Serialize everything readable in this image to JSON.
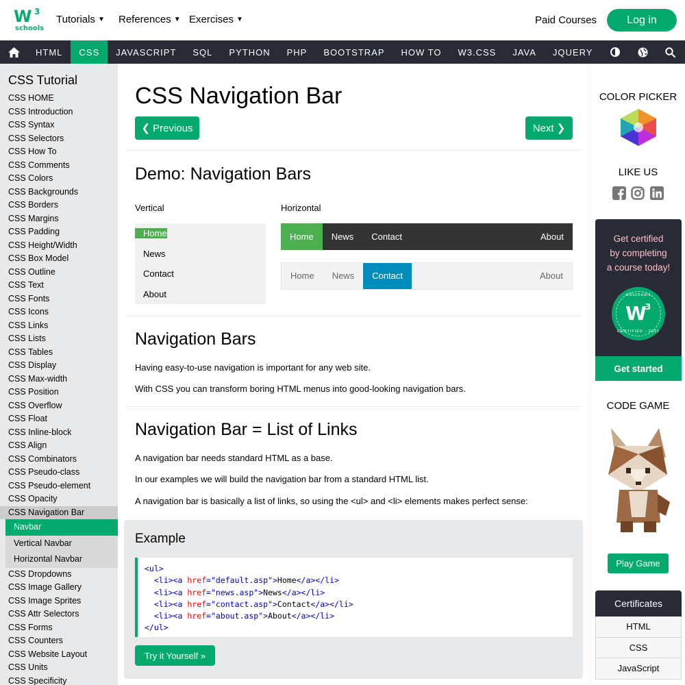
{
  "header": {
    "logo_main": "W",
    "logo_sup": "3",
    "logo_sub": "schools",
    "menus": [
      {
        "label": "Tutorials"
      },
      {
        "label": "References"
      },
      {
        "label": "Exercises"
      }
    ],
    "paid_courses": "Paid Courses",
    "login": "Log in"
  },
  "nav": {
    "items": [
      "HTML",
      "CSS",
      "JAVASCRIPT",
      "SQL",
      "PYTHON",
      "PHP",
      "BOOTSTRAP",
      "HOW TO",
      "W3.CSS",
      "JAVA",
      "JQUERY"
    ],
    "active": "CSS"
  },
  "sidebar": {
    "title": "CSS Tutorial",
    "items_top": [
      "CSS HOME",
      "CSS Introduction",
      "CSS Syntax",
      "CSS Selectors",
      "CSS How To",
      "CSS Comments",
      "CSS Colors",
      "CSS Backgrounds",
      "CSS Borders",
      "CSS Margins",
      "CSS Padding",
      "CSS Height/Width",
      "CSS Box Model",
      "CSS Outline",
      "CSS Text",
      "CSS Fonts",
      "CSS Icons",
      "CSS Links",
      "CSS Lists",
      "CSS Tables",
      "CSS Display",
      "CSS Max-width",
      "CSS Position",
      "CSS Overflow",
      "CSS Float",
      "CSS Inline-block",
      "CSS Align",
      "CSS Combinators",
      "CSS Pseudo-class",
      "CSS Pseudo-element",
      "CSS Opacity"
    ],
    "current": "CSS Navigation Bar",
    "subitems": [
      "Navbar",
      "Vertical Navbar",
      "Horizontal Navbar"
    ],
    "items_bottom": [
      "CSS Dropdowns",
      "CSS Image Gallery",
      "CSS Image Sprites",
      "CSS Attr Selectors",
      "CSS Forms",
      "CSS Counters",
      "CSS Website Layout",
      "CSS Units",
      "CSS Specificity"
    ]
  },
  "main": {
    "title": "CSS Navigation Bar",
    "prev": "❮ Previous",
    "next": "Next ❯",
    "demo_title": "Demo: Navigation Bars",
    "vertical_label": "Vertical",
    "horizontal_label": "Horizontal",
    "vertical_items": [
      "Home",
      "News",
      "Contact",
      "About"
    ],
    "h1_items": [
      "Home",
      "News",
      "Contact"
    ],
    "h1_right": "About",
    "h2_items": [
      "Home",
      "News",
      "Contact"
    ],
    "h2_right": "About",
    "nb_title": "Navigation Bars",
    "nb_p1": "Having easy-to-use navigation is important for any web site.",
    "nb_p2": "With CSS you can transform boring HTML menus into good-looking navigation bars.",
    "list_title": "Navigation Bar = List of Links",
    "list_p1": "A navigation bar needs standard HTML as a base.",
    "list_p2": "In our examples we will build the navigation bar from a standard HTML list.",
    "list_p3": "A navigation bar is basically a list of links, so using the <ul> and <li> elements makes perfect sense:",
    "example_title": "Example",
    "code_lines": [
      {
        "indent": "",
        "open": "<ul>"
      },
      {
        "indent": "  ",
        "href": "default.asp",
        "text": "Home"
      },
      {
        "indent": "  ",
        "href": "news.asp",
        "text": "News"
      },
      {
        "indent": "  ",
        "href": "contact.asp",
        "text": "Contact"
      },
      {
        "indent": "  ",
        "href": "about.asp",
        "text": "About"
      },
      {
        "indent": "",
        "open": "</ul>"
      }
    ],
    "try_it": "Try it Yourself »"
  },
  "right": {
    "color_picker": "COLOR PICKER",
    "like_us": "LIKE US",
    "cert_line1": "Get certified",
    "cert_line2": "by completing",
    "cert_line3": "a course today!",
    "badge_top": "w3schools",
    "badge_bottom": "CERTIFIED · 2021",
    "get_started": "Get started",
    "code_game": "CODE GAME",
    "play_game": "Play Game",
    "certificates": "Certificates",
    "cert_items": [
      "HTML",
      "CSS",
      "JavaScript"
    ]
  },
  "colors": {
    "accent": "#04AA6D",
    "navbar_bg": "#282A35",
    "sidebar_bg": "#E7E9EB",
    "demo_green": "#4CAF50",
    "demo_blue": "#008CBA",
    "cert_text": "#FFC0C7"
  }
}
